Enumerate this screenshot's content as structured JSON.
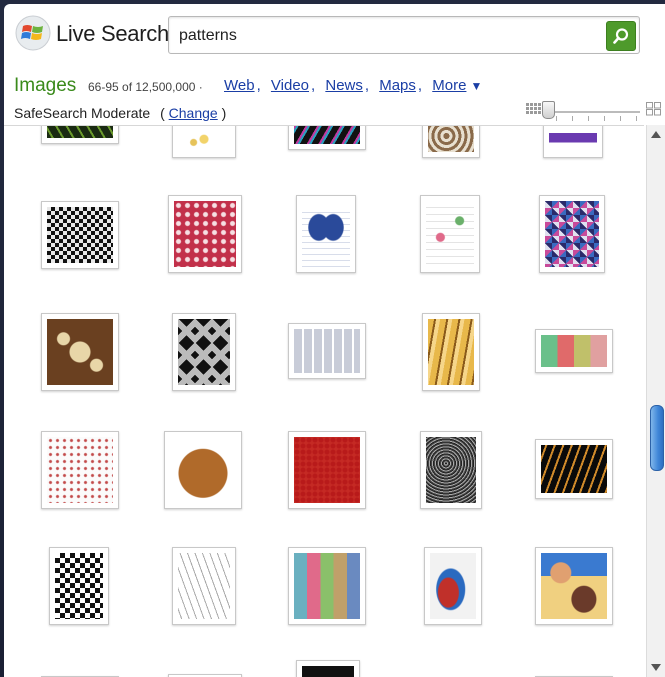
{
  "header": {
    "brand": "Live Search",
    "logo_icon": "windows-flag-icon",
    "search_value": "patterns",
    "search_button_icon": "magnifier-icon"
  },
  "results_bar": {
    "vertical": "Images",
    "count": "66-95 of 12,500,000 ·",
    "links": [
      "Web",
      "Video",
      "News",
      "Maps",
      "More"
    ],
    "more_caret": "▼"
  },
  "safesearch": {
    "label": "SafeSearch Moderate",
    "open_paren": "(",
    "link": "Change",
    "close_paren": ")"
  },
  "size_control": {
    "small_icon": "small-thumbnails-icon",
    "large_icon": "large-thumbnails-icon",
    "level": 0
  },
  "colors": {
    "brand_green": "#3a8a1b",
    "link_blue": "#1a3ea5",
    "search_button": "#4e9a2b",
    "scroll_thumb": "#3f86d8"
  }
}
